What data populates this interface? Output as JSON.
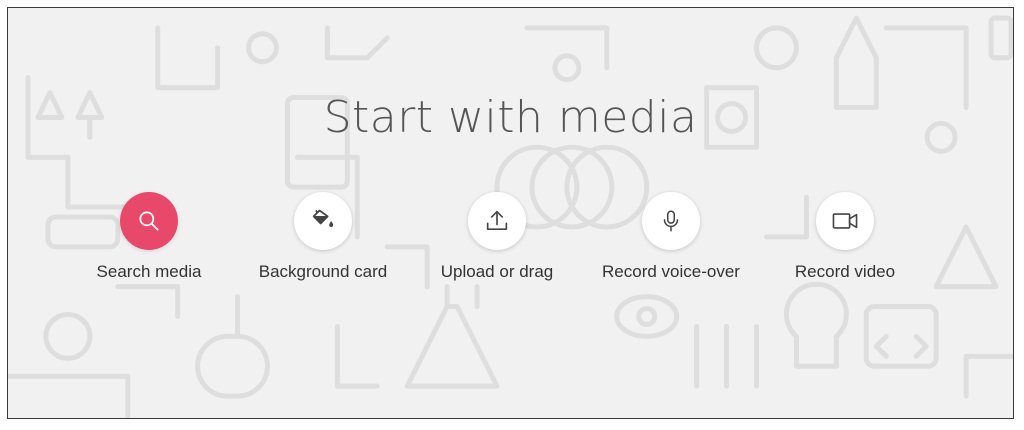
{
  "title": "Start with media",
  "accent_color": "#e8496b",
  "actions": [
    {
      "label": "Search media",
      "icon": "search-icon",
      "primary": true
    },
    {
      "label": "Background card",
      "icon": "paint-bucket-icon",
      "primary": false
    },
    {
      "label": "Upload or drag",
      "icon": "upload-icon",
      "primary": false
    },
    {
      "label": "Record voice-over",
      "icon": "microphone-icon",
      "primary": false
    },
    {
      "label": "Record video",
      "icon": "video-camera-icon",
      "primary": false
    }
  ]
}
